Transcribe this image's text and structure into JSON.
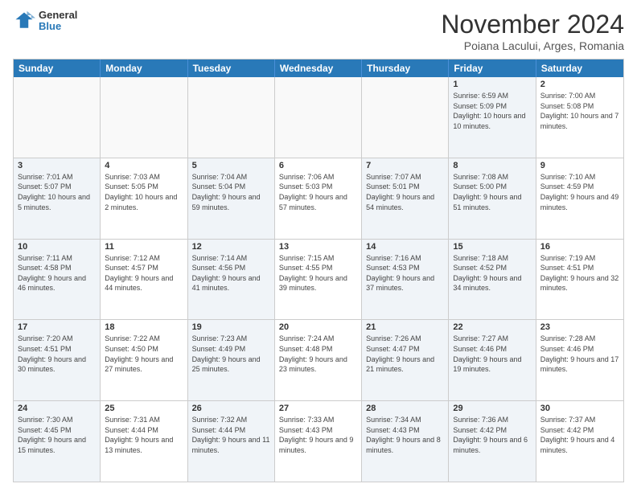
{
  "header": {
    "logo": {
      "general": "General",
      "blue": "Blue"
    },
    "title": "November 2024",
    "location": "Poiana Lacului, Arges, Romania"
  },
  "weekdays": [
    "Sunday",
    "Monday",
    "Tuesday",
    "Wednesday",
    "Thursday",
    "Friday",
    "Saturday"
  ],
  "rows": [
    [
      {
        "day": "",
        "info": "",
        "empty": true
      },
      {
        "day": "",
        "info": "",
        "empty": true
      },
      {
        "day": "",
        "info": "",
        "empty": true
      },
      {
        "day": "",
        "info": "",
        "empty": true
      },
      {
        "day": "",
        "info": "",
        "empty": true
      },
      {
        "day": "1",
        "info": "Sunrise: 6:59 AM\nSunset: 5:09 PM\nDaylight: 10 hours and 10 minutes.",
        "shaded": true
      },
      {
        "day": "2",
        "info": "Sunrise: 7:00 AM\nSunset: 5:08 PM\nDaylight: 10 hours and 7 minutes.",
        "shaded": false
      }
    ],
    [
      {
        "day": "3",
        "info": "Sunrise: 7:01 AM\nSunset: 5:07 PM\nDaylight: 10 hours and 5 minutes.",
        "shaded": true
      },
      {
        "day": "4",
        "info": "Sunrise: 7:03 AM\nSunset: 5:05 PM\nDaylight: 10 hours and 2 minutes.",
        "shaded": false
      },
      {
        "day": "5",
        "info": "Sunrise: 7:04 AM\nSunset: 5:04 PM\nDaylight: 9 hours and 59 minutes.",
        "shaded": true
      },
      {
        "day": "6",
        "info": "Sunrise: 7:06 AM\nSunset: 5:03 PM\nDaylight: 9 hours and 57 minutes.",
        "shaded": false
      },
      {
        "day": "7",
        "info": "Sunrise: 7:07 AM\nSunset: 5:01 PM\nDaylight: 9 hours and 54 minutes.",
        "shaded": true
      },
      {
        "day": "8",
        "info": "Sunrise: 7:08 AM\nSunset: 5:00 PM\nDaylight: 9 hours and 51 minutes.",
        "shaded": true
      },
      {
        "day": "9",
        "info": "Sunrise: 7:10 AM\nSunset: 4:59 PM\nDaylight: 9 hours and 49 minutes.",
        "shaded": false
      }
    ],
    [
      {
        "day": "10",
        "info": "Sunrise: 7:11 AM\nSunset: 4:58 PM\nDaylight: 9 hours and 46 minutes.",
        "shaded": true
      },
      {
        "day": "11",
        "info": "Sunrise: 7:12 AM\nSunset: 4:57 PM\nDaylight: 9 hours and 44 minutes.",
        "shaded": false
      },
      {
        "day": "12",
        "info": "Sunrise: 7:14 AM\nSunset: 4:56 PM\nDaylight: 9 hours and 41 minutes.",
        "shaded": true
      },
      {
        "day": "13",
        "info": "Sunrise: 7:15 AM\nSunset: 4:55 PM\nDaylight: 9 hours and 39 minutes.",
        "shaded": false
      },
      {
        "day": "14",
        "info": "Sunrise: 7:16 AM\nSunset: 4:53 PM\nDaylight: 9 hours and 37 minutes.",
        "shaded": true
      },
      {
        "day": "15",
        "info": "Sunrise: 7:18 AM\nSunset: 4:52 PM\nDaylight: 9 hours and 34 minutes.",
        "shaded": true
      },
      {
        "day": "16",
        "info": "Sunrise: 7:19 AM\nSunset: 4:51 PM\nDaylight: 9 hours and 32 minutes.",
        "shaded": false
      }
    ],
    [
      {
        "day": "17",
        "info": "Sunrise: 7:20 AM\nSunset: 4:51 PM\nDaylight: 9 hours and 30 minutes.",
        "shaded": true
      },
      {
        "day": "18",
        "info": "Sunrise: 7:22 AM\nSunset: 4:50 PM\nDaylight: 9 hours and 27 minutes.",
        "shaded": false
      },
      {
        "day": "19",
        "info": "Sunrise: 7:23 AM\nSunset: 4:49 PM\nDaylight: 9 hours and 25 minutes.",
        "shaded": true
      },
      {
        "day": "20",
        "info": "Sunrise: 7:24 AM\nSunset: 4:48 PM\nDaylight: 9 hours and 23 minutes.",
        "shaded": false
      },
      {
        "day": "21",
        "info": "Sunrise: 7:26 AM\nSunset: 4:47 PM\nDaylight: 9 hours and 21 minutes.",
        "shaded": true
      },
      {
        "day": "22",
        "info": "Sunrise: 7:27 AM\nSunset: 4:46 PM\nDaylight: 9 hours and 19 minutes.",
        "shaded": true
      },
      {
        "day": "23",
        "info": "Sunrise: 7:28 AM\nSunset: 4:46 PM\nDaylight: 9 hours and 17 minutes.",
        "shaded": false
      }
    ],
    [
      {
        "day": "24",
        "info": "Sunrise: 7:30 AM\nSunset: 4:45 PM\nDaylight: 9 hours and 15 minutes.",
        "shaded": true
      },
      {
        "day": "25",
        "info": "Sunrise: 7:31 AM\nSunset: 4:44 PM\nDaylight: 9 hours and 13 minutes.",
        "shaded": false
      },
      {
        "day": "26",
        "info": "Sunrise: 7:32 AM\nSunset: 4:44 PM\nDaylight: 9 hours and 11 minutes.",
        "shaded": true
      },
      {
        "day": "27",
        "info": "Sunrise: 7:33 AM\nSunset: 4:43 PM\nDaylight: 9 hours and 9 minutes.",
        "shaded": false
      },
      {
        "day": "28",
        "info": "Sunrise: 7:34 AM\nSunset: 4:43 PM\nDaylight: 9 hours and 8 minutes.",
        "shaded": true
      },
      {
        "day": "29",
        "info": "Sunrise: 7:36 AM\nSunset: 4:42 PM\nDaylight: 9 hours and 6 minutes.",
        "shaded": true
      },
      {
        "day": "30",
        "info": "Sunrise: 7:37 AM\nSunset: 4:42 PM\nDaylight: 9 hours and 4 minutes.",
        "shaded": false
      }
    ]
  ]
}
